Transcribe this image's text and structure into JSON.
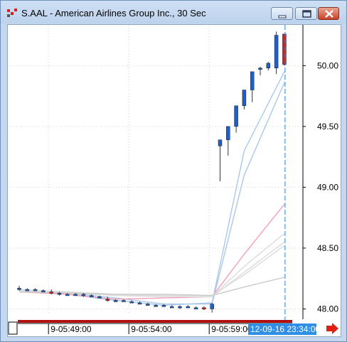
{
  "window": {
    "title": "S.AAL - American Airlines Group Inc., 30 Sec",
    "buttons": {
      "minimize": "minimize-icon",
      "maximize": "maximize-icon",
      "close": "close-icon"
    }
  },
  "colors": {
    "up_candle": "#1f5fc6",
    "down_candle": "#d42020",
    "cursor_line": "#1f7fe0",
    "scrollbar": "#b01010",
    "nav_arrow": "#e02010"
  },
  "navigation": {
    "arrow_icon": "right-arrow-icon"
  },
  "chart_data": {
    "type": "candlestick",
    "symbol": "S.AAL",
    "interval": "30 Sec",
    "ylim": [
      47.95,
      50.3
    ],
    "y_ticks": [
      "50.00",
      "49.50",
      "49.00",
      "48.50",
      "48.00"
    ],
    "y_tick_values": [
      50.0,
      49.5,
      49.0,
      48.5,
      48.0
    ],
    "x_ticks": [
      "9-05:49:00",
      "9-05:54:00",
      "9-05:59:00"
    ],
    "x_tick_index": [
      4,
      14,
      24
    ],
    "cursor_label": "12-09-16 23:34:00",
    "grid": true,
    "candles": [
      {
        "o": 48.16,
        "h": 48.19,
        "l": 48.15,
        "c": 48.17
      },
      {
        "o": 48.16,
        "h": 48.17,
        "l": 48.15,
        "c": 48.16
      },
      {
        "o": 48.16,
        "h": 48.17,
        "l": 48.15,
        "c": 48.16
      },
      {
        "o": 48.15,
        "h": 48.16,
        "l": 48.14,
        "c": 48.15
      },
      {
        "o": 48.14,
        "h": 48.16,
        "l": 48.12,
        "c": 48.13
      },
      {
        "o": 48.12,
        "h": 48.14,
        "l": 48.11,
        "c": 48.13
      },
      {
        "o": 48.12,
        "h": 48.13,
        "l": 48.11,
        "c": 48.12
      },
      {
        "o": 48.12,
        "h": 48.13,
        "l": 48.11,
        "c": 48.12
      },
      {
        "o": 48.11,
        "h": 48.13,
        "l": 48.1,
        "c": 48.12
      },
      {
        "o": 48.11,
        "h": 48.12,
        "l": 48.1,
        "c": 48.11
      },
      {
        "o": 48.1,
        "h": 48.11,
        "l": 48.09,
        "c": 48.1
      },
      {
        "o": 48.08,
        "h": 48.1,
        "l": 48.06,
        "c": 48.07
      },
      {
        "o": 48.07,
        "h": 48.08,
        "l": 48.06,
        "c": 48.07
      },
      {
        "o": 48.07,
        "h": 48.08,
        "l": 48.06,
        "c": 48.07
      },
      {
        "o": 48.06,
        "h": 48.07,
        "l": 48.05,
        "c": 48.06
      },
      {
        "o": 48.05,
        "h": 48.06,
        "l": 48.04,
        "c": 48.05
      },
      {
        "o": 48.04,
        "h": 48.05,
        "l": 48.03,
        "c": 48.04
      },
      {
        "o": 48.03,
        "h": 48.04,
        "l": 48.02,
        "c": 48.03
      },
      {
        "o": 48.03,
        "h": 48.04,
        "l": 48.02,
        "c": 48.03
      },
      {
        "o": 48.02,
        "h": 48.03,
        "l": 48.01,
        "c": 48.02
      },
      {
        "o": 48.01,
        "h": 48.03,
        "l": 48.0,
        "c": 48.02
      },
      {
        "o": 48.02,
        "h": 48.03,
        "l": 48.01,
        "c": 48.02
      },
      {
        "o": 48.01,
        "h": 48.02,
        "l": 48.0,
        "c": 48.01
      },
      {
        "o": 48.01,
        "h": 48.02,
        "l": 47.99,
        "c": 48.0
      },
      {
        "o": 48.0,
        "h": 48.05,
        "l": 47.97,
        "c": 48.04
      },
      {
        "o": 49.34,
        "h": 49.39,
        "l": 49.05,
        "c": 49.39
      },
      {
        "o": 49.39,
        "h": 49.5,
        "l": 49.26,
        "c": 49.5
      },
      {
        "o": 49.5,
        "h": 49.67,
        "l": 49.45,
        "c": 49.67
      },
      {
        "o": 49.67,
        "h": 49.8,
        "l": 49.64,
        "c": 49.8
      },
      {
        "o": 49.8,
        "h": 49.95,
        "l": 49.7,
        "c": 49.95
      },
      {
        "o": 49.97,
        "h": 49.99,
        "l": 49.92,
        "c": 49.98
      },
      {
        "o": 49.98,
        "h": 50.03,
        "l": 49.96,
        "c": 50.02
      },
      {
        "o": 49.98,
        "h": 50.28,
        "l": 49.93,
        "c": 50.25
      },
      {
        "o": 50.26,
        "h": 50.26,
        "l": 50.0,
        "c": 50.01
      }
    ],
    "series": [
      {
        "color": "#a9c8ec",
        "values": [
          48.16,
          48.12,
          48.07,
          48.03,
          48.05,
          49.3,
          49.95
        ]
      },
      {
        "color": "#a9c8ec",
        "values": [
          48.16,
          48.13,
          48.09,
          48.04,
          48.04,
          49.1,
          49.86
        ]
      },
      {
        "color": "#f3a0b8",
        "values": [
          48.14,
          48.12,
          48.08,
          48.09,
          48.1,
          48.45,
          48.86
        ]
      },
      {
        "color": "#dcdcdc",
        "values": [
          48.16,
          48.14,
          48.12,
          48.1,
          48.1,
          48.35,
          48.62
        ]
      },
      {
        "color": "#dcdcdc",
        "values": [
          48.15,
          48.13,
          48.11,
          48.1,
          48.1,
          48.3,
          48.55
        ]
      },
      {
        "color": "#dcdcdc",
        "values": [
          48.15,
          48.14,
          48.12,
          48.11,
          48.11,
          48.28,
          48.52
        ]
      },
      {
        "color": "#c9c9c9",
        "values": [
          48.14,
          48.13,
          48.12,
          48.12,
          48.11,
          48.18,
          48.26
        ]
      }
    ],
    "series_x_index": [
      0,
      6,
      12,
      18,
      24,
      28,
      33
    ]
  }
}
